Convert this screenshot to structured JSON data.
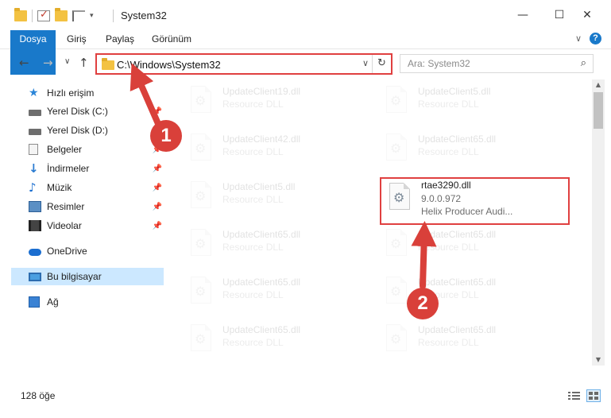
{
  "window": {
    "title": "System32",
    "minimize_glyph": "—",
    "maximize_glyph": "☐",
    "close_glyph": "✕"
  },
  "ribbon": {
    "tabs": [
      {
        "label": "Dosya",
        "active": true
      },
      {
        "label": "Giriş"
      },
      {
        "label": "Paylaş"
      },
      {
        "label": "Görünüm"
      }
    ],
    "expand_glyph": "∨",
    "help_glyph": "?"
  },
  "navigation": {
    "back_glyph": "←",
    "forward_glyph": "→",
    "recent_glyph": "∨",
    "up_glyph": "↑",
    "address": "C:\\Windows\\System32",
    "address_dropdown_glyph": "∨",
    "refresh_glyph": "↻",
    "search_placeholder": "Ara: System32",
    "search_glyph": "⌕"
  },
  "sidebar": {
    "items": [
      {
        "label": "Hızlı erişim",
        "icon": "star-icon",
        "pinned": false
      },
      {
        "label": "Yerel Disk (C:)",
        "icon": "drive-icon",
        "pinned": true
      },
      {
        "label": "Yerel Disk (D:)",
        "icon": "drive-icon",
        "pinned": true
      },
      {
        "label": "Belgeler",
        "icon": "documents-icon",
        "pinned": true
      },
      {
        "label": "İndirmeler",
        "icon": "download-icon",
        "pinned": true
      },
      {
        "label": "Müzik",
        "icon": "music-icon",
        "pinned": true
      },
      {
        "label": "Resimler",
        "icon": "pictures-icon",
        "pinned": true
      },
      {
        "label": "Videolar",
        "icon": "videos-icon",
        "pinned": true
      },
      {
        "label": "OneDrive",
        "icon": "cloud-icon",
        "pinned": false
      },
      {
        "label": "Bu bilgisayar",
        "icon": "computer-icon",
        "pinned": false,
        "selected": true
      },
      {
        "label": "Ağ",
        "icon": "network-icon",
        "pinned": false
      }
    ],
    "pin_glyph": "📌"
  },
  "files": {
    "faded": [
      {
        "name": "UpdateClient19.dll",
        "type": "Resource DLL"
      },
      {
        "name": "UpdateClient5.dll",
        "type": "Resource DLL"
      },
      {
        "name": "UpdateClient42.dll",
        "type": "Resource DLL"
      },
      {
        "name": "UpdateClient65.dll",
        "type": "Resource DLL"
      },
      {
        "name": "UpdateClient5.dll",
        "type": "Resource DLL"
      },
      {
        "name": "UpdateClient65.dll",
        "type": "Resource DLL"
      },
      {
        "name": "UpdateClient65.dll",
        "type": "Resource DLL"
      },
      {
        "name": "UpdateClient65.dll",
        "type": "Resource DLL"
      },
      {
        "name": "UpdateClient65.dll",
        "type": "Resource DLL"
      },
      {
        "name": "UpdateClient65.dll",
        "type": "Resource DLL"
      },
      {
        "name": "UpdateClient65.dll",
        "type": "Resource DLL"
      }
    ],
    "highlighted": {
      "name": "rtae3290.dll",
      "version": "9.0.0.972",
      "description": "Helix Producer Audi..."
    },
    "file_icon_glyph": "⚙"
  },
  "annotations": {
    "callout_1": "1",
    "callout_2": "2",
    "color": "#d9403a"
  },
  "status": {
    "item_count": "128 öğe"
  },
  "colors": {
    "accent": "#1979ca",
    "highlight": "#e04040",
    "selected_bg": "#cce8ff"
  }
}
